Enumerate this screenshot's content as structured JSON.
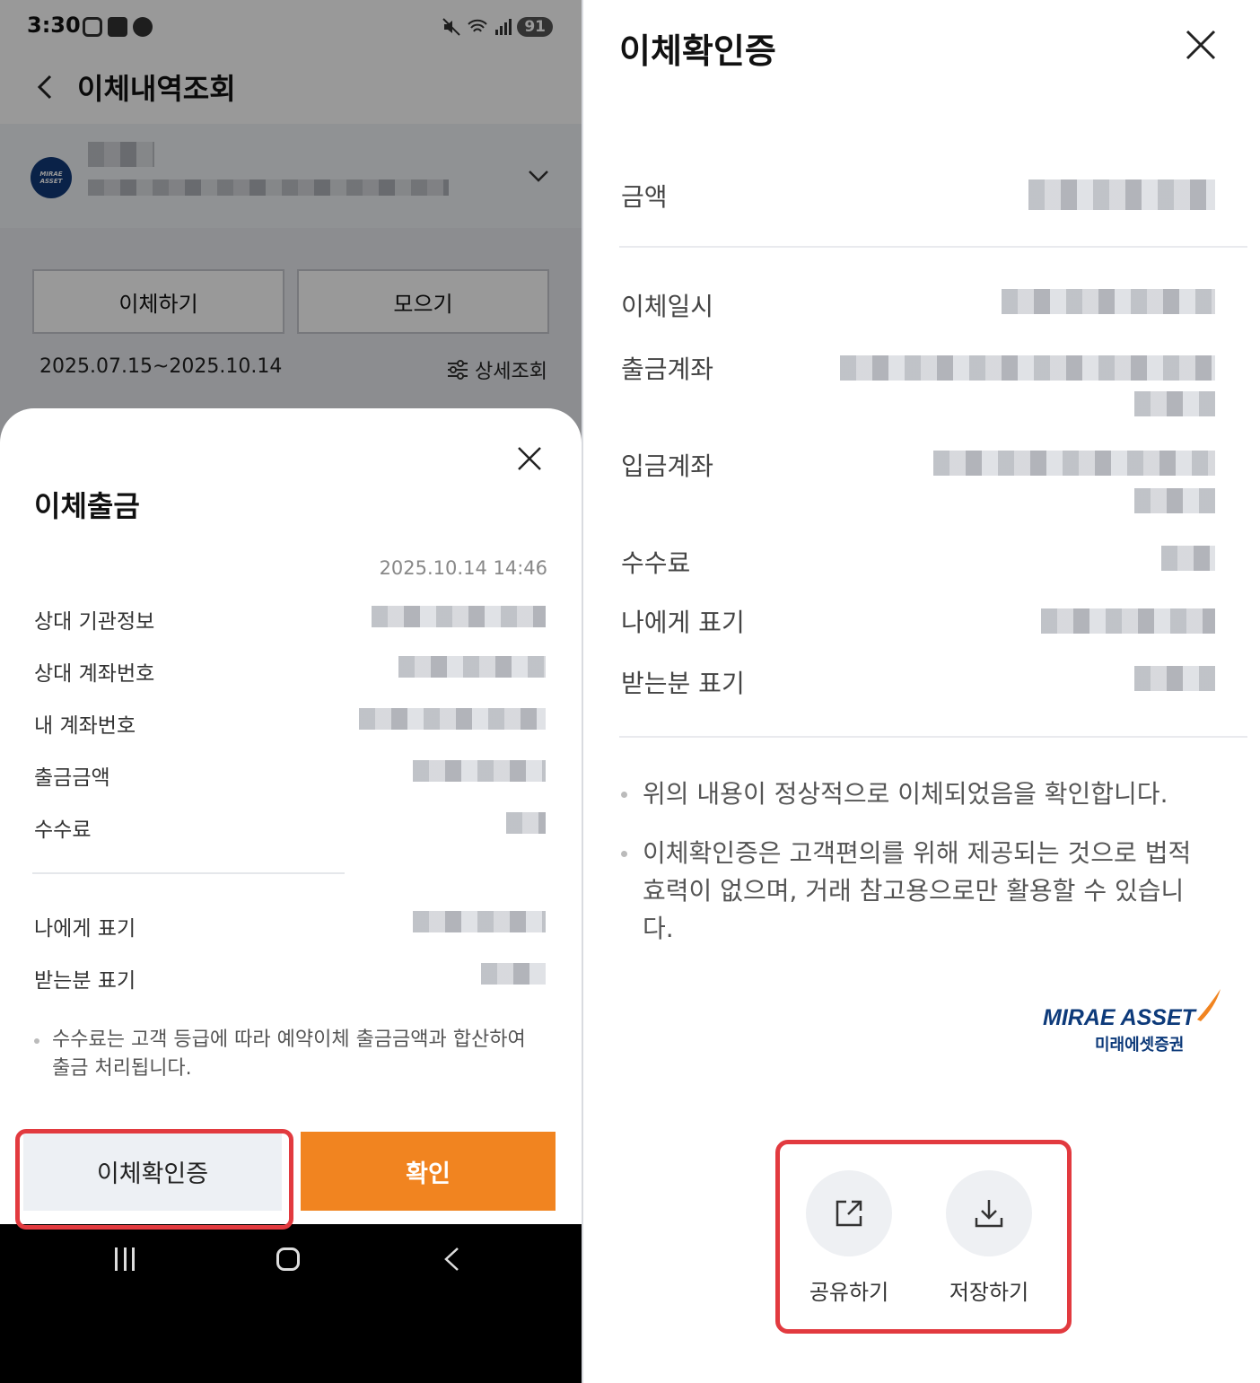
{
  "left": {
    "status": {
      "time": "3:30",
      "battery": "91"
    },
    "appbar": {
      "title": "이체내역조회"
    },
    "account": {
      "logo_text": "MIRAE ASSET"
    },
    "buttons": {
      "transfer": "이체하기",
      "collect": "모으기"
    },
    "filter": {
      "date_range": "2025.07.15~2025.10.14",
      "detail_search": "상세조회"
    },
    "sheet": {
      "title": "이체출금",
      "datetime": "2025.10.14 14:46",
      "rows": [
        {
          "label": "상대 기관정보"
        },
        {
          "label": "상대 계좌번호"
        },
        {
          "label": "내 계좌번호"
        },
        {
          "label": "출금금액"
        },
        {
          "label": "수수료"
        }
      ],
      "memo_rows": [
        {
          "label": "나에게 표기"
        },
        {
          "label": "받는분 표기"
        }
      ],
      "note": "수수료는 고객 등급에 따라 예약이체 출금금액과 합산하여 출금 처리됩니다.",
      "cert_button": "이체확인증",
      "ok_button": "확인"
    }
  },
  "right": {
    "title": "이체확인증",
    "rows": [
      {
        "label": "금액"
      },
      {
        "label": "이체일시"
      },
      {
        "label": "출금계좌"
      },
      {
        "label": "입금계좌"
      },
      {
        "label": "수수료"
      },
      {
        "label": "나에게 표기"
      },
      {
        "label": "받는분 표기"
      }
    ],
    "notes": [
      "위의 내용이 정상적으로 이체되었음을 확인합니다.",
      "이체확인증은 고객편의를 위해 제공되는 것으로 법적 효력이 없으며, 거래 참고용으로만 활용할 수 있습니다."
    ],
    "logo": {
      "en": "MIRAE ASSET",
      "ko": "미래에셋증권"
    },
    "actions": {
      "share": "공유하기",
      "save": "저장하기"
    }
  },
  "colors": {
    "accent": "#f18420",
    "highlight": "#e23a3f",
    "brand": "#0d3a7a"
  }
}
